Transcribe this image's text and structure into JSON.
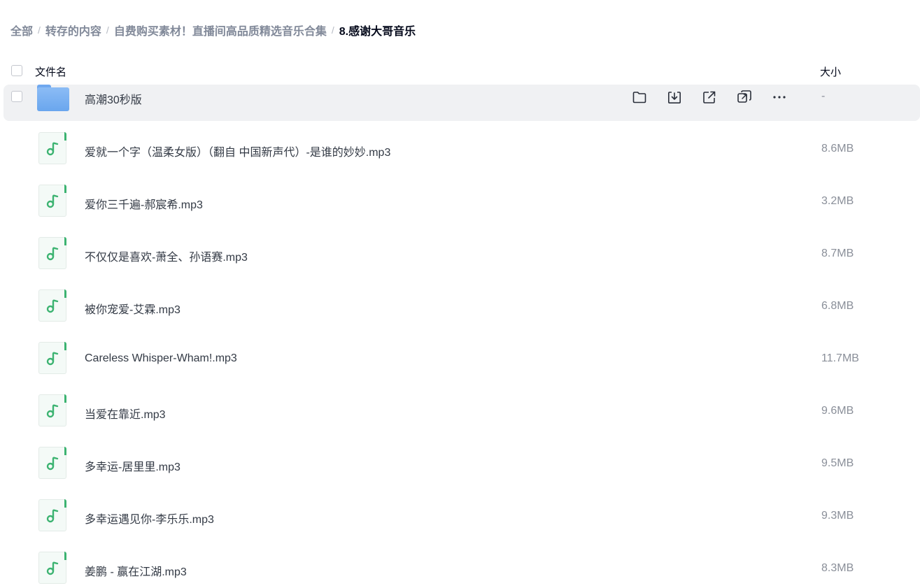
{
  "breadcrumb": {
    "items": [
      "全部",
      "转存的内容",
      "自费购买素材！直播间高品质精选音乐合集",
      "8.感谢大哥音乐"
    ],
    "separator": "/"
  },
  "header": {
    "name_label": "文件名",
    "size_label": "大小"
  },
  "files": [
    {
      "name": "高潮30秒版",
      "size": "-",
      "type": "folder"
    },
    {
      "name": "爱就一个字（温柔女版）（翻自 中国新声代）-是谁的妙妙.mp3",
      "size": "8.6MB",
      "type": "audio"
    },
    {
      "name": "爱你三千遍-郝宸希.mp3",
      "size": "3.2MB",
      "type": "audio"
    },
    {
      "name": "不仅仅是喜欢-萧全、孙语赛.mp3",
      "size": "8.7MB",
      "type": "audio"
    },
    {
      "name": "被你宠爱-艾霖.mp3",
      "size": "6.8MB",
      "type": "audio"
    },
    {
      "name": "Careless Whisper-Wham!.mp3",
      "size": "11.7MB",
      "type": "audio"
    },
    {
      "name": "当爱在靠近.mp3",
      "size": "9.6MB",
      "type": "audio"
    },
    {
      "name": "多幸运-居里里.mp3",
      "size": "9.5MB",
      "type": "audio"
    },
    {
      "name": "多幸运遇见你-李乐乐.mp3",
      "size": "9.3MB",
      "type": "audio"
    },
    {
      "name": "姜鹏 - 赢在江湖.mp3",
      "size": "8.3MB",
      "type": "audio"
    }
  ],
  "row_actions": [
    "folder-icon",
    "download-icon",
    "share-icon",
    "copy-link-icon",
    "more-icon"
  ],
  "colors": {
    "accent_green": "#3cb371",
    "folder_blue": "#6fa8ef",
    "hover_row": "#f0f1f3"
  }
}
